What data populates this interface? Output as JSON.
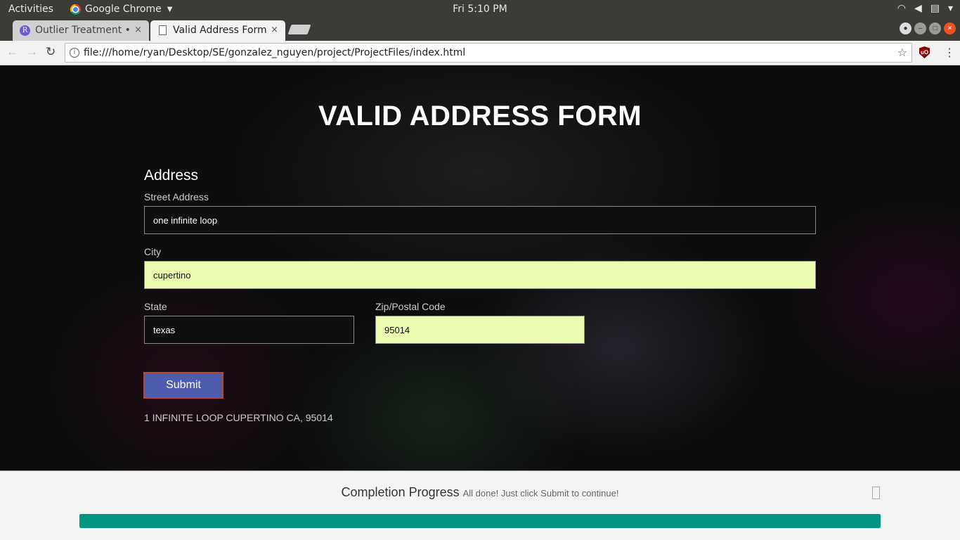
{
  "os_bar": {
    "activities": "Activities",
    "app_name": "Google Chrome",
    "clock": "Fri  5:10 PM",
    "tray_icons": [
      "wifi-icon",
      "volume-icon",
      "clipboard-icon",
      "power-icon"
    ]
  },
  "browser": {
    "tabs": [
      {
        "label": "Outlier Treatment •",
        "active": false,
        "icon": "r-logo-icon"
      },
      {
        "label": "Valid Address Form",
        "active": true,
        "icon": "document-icon"
      }
    ],
    "tab_close_glyph": "×",
    "url": "file:///home/ryan/Desktop/SE/gonzalez_nguyen/project/ProjectFiles/index.html"
  },
  "page": {
    "title": "VALID ADDRESS FORM",
    "section_heading": "Address",
    "fields": {
      "street": {
        "label": "Street Address",
        "value": "one infinite loop"
      },
      "city": {
        "label": "City",
        "value": "cupertino"
      },
      "state": {
        "label": "State",
        "value": "texas"
      },
      "zip": {
        "label": "Zip/Postal Code",
        "value": "95014"
      }
    },
    "submit_label": "Submit",
    "result": "1 INFINITE LOOP CUPERTINO CA, 95014"
  },
  "progress": {
    "title": "Completion Progress",
    "message": "All done! Just click Submit to continue!",
    "percent": 100,
    "color": "#00967f"
  },
  "colors": {
    "accent_button": "#4d5cad",
    "validated_field": "#ebfcb1"
  }
}
